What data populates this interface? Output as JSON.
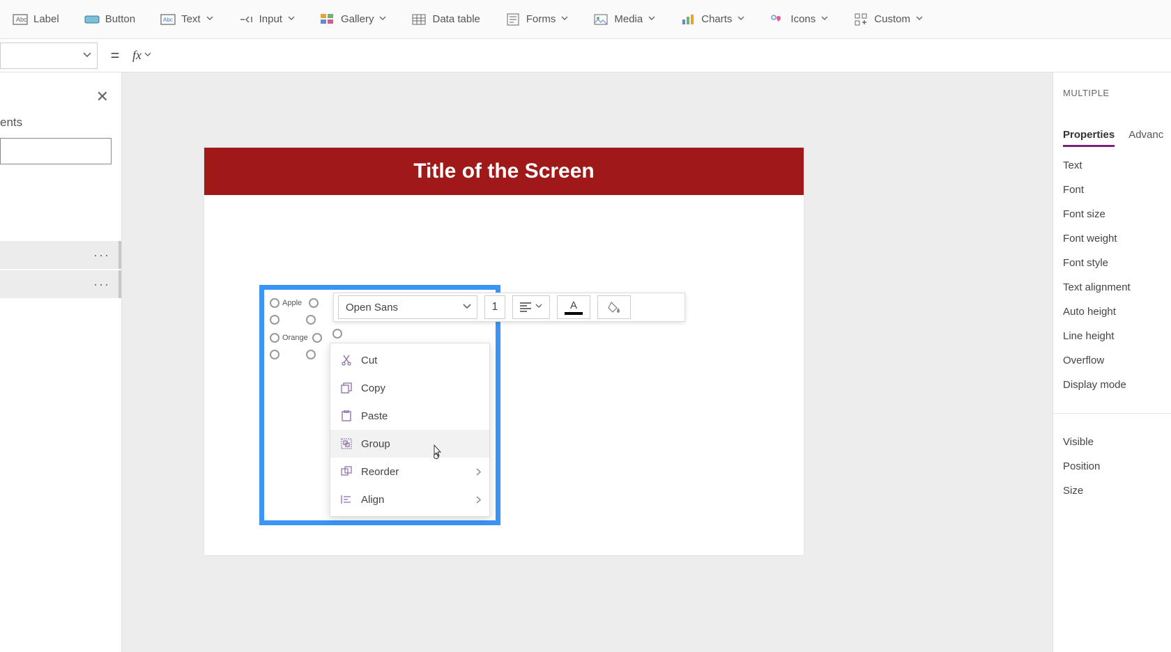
{
  "ribbon": {
    "items": [
      {
        "label": "Label",
        "hasChevron": false
      },
      {
        "label": "Button",
        "hasChevron": false
      },
      {
        "label": "Text",
        "hasChevron": true
      },
      {
        "label": "Input",
        "hasChevron": true
      },
      {
        "label": "Gallery",
        "hasChevron": true
      },
      {
        "label": "Data table",
        "hasChevron": false
      },
      {
        "label": "Forms",
        "hasChevron": true
      },
      {
        "label": "Media",
        "hasChevron": true
      },
      {
        "label": "Charts",
        "hasChevron": true
      },
      {
        "label": "Icons",
        "hasChevron": true
      },
      {
        "label": "Custom",
        "hasChevron": true
      }
    ]
  },
  "formula": {
    "equals": "=",
    "fx": "fx"
  },
  "leftPanel": {
    "title": "ents"
  },
  "screen": {
    "title": "Title of the Screen"
  },
  "selectedLabels": {
    "label1": "Apple",
    "label2": "Orange"
  },
  "formatToolbar": {
    "font": "Open Sans",
    "sizeFragment": "1"
  },
  "contextMenu": {
    "items": [
      {
        "label": "Cut",
        "submenu": false,
        "hover": false
      },
      {
        "label": "Copy",
        "submenu": false,
        "hover": false
      },
      {
        "label": "Paste",
        "submenu": false,
        "hover": false
      },
      {
        "label": "Group",
        "submenu": false,
        "hover": true
      },
      {
        "label": "Reorder",
        "submenu": true,
        "hover": false
      },
      {
        "label": "Align",
        "submenu": true,
        "hover": false
      }
    ]
  },
  "properties": {
    "title": "MULTIPLE",
    "tabs": {
      "active": "Properties",
      "other": "Advanc"
    },
    "groups": {
      "text": [
        "Text",
        "Font",
        "Font size",
        "Font weight",
        "Font style",
        "Text alignment",
        "Auto height",
        "Line height",
        "Overflow",
        "Display mode"
      ],
      "layout": [
        "Visible",
        "Position",
        "Size"
      ]
    }
  }
}
